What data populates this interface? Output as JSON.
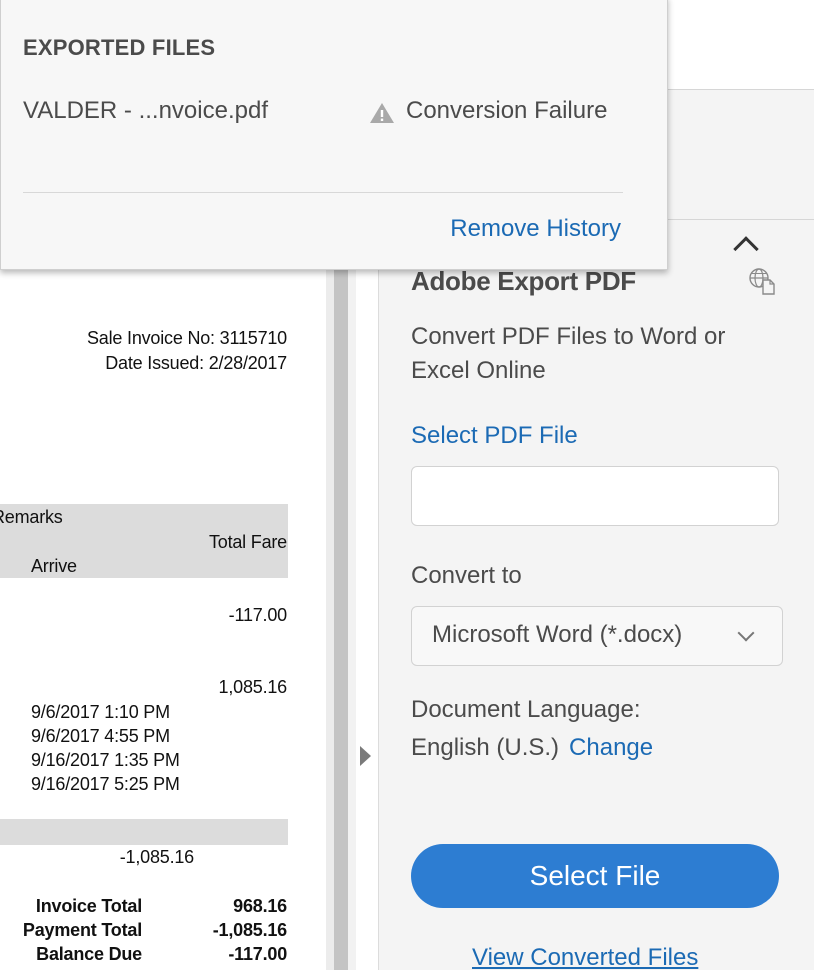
{
  "exported_files_popup": {
    "heading": "EXPORTED FILES",
    "file_name": "VALDER - ...nvoice.pdf",
    "status": "Conversion Failure",
    "remove_history": "Remove History"
  },
  "document": {
    "sale_invoice_no": "Sale Invoice No: 3115710",
    "date_issued": "Date Issued: 2/28/2017",
    "header_remarks": "Remarks",
    "header_total_fare": "Total Fare",
    "header_arrive": "Arrive",
    "amount_1": "-117.00",
    "amount_2": "1,085.16",
    "dates": [
      "9/6/2017 1:10 PM",
      "9/6/2017 4:55 PM",
      "9/16/2017 1:35 PM",
      "9/16/2017 5:25 PM"
    ],
    "amount_3": "-1,085.16",
    "totals": [
      {
        "label": "Invoice Total",
        "value": "968.16"
      },
      {
        "label": "Payment Total",
        "value": "-1,085.16"
      },
      {
        "label": "Balance Due",
        "value": "-117.00"
      }
    ]
  },
  "export_panel": {
    "title": "Adobe Export PDF",
    "description": "Convert PDF Files to Word or Excel Online",
    "select_pdf_link": "Select PDF File",
    "convert_to_label": "Convert to",
    "format_selected": "Microsoft Word (*.docx)",
    "doc_language_label": "Document Language:",
    "language": "English (U.S.)",
    "change_link": "Change",
    "select_file_button": "Select File",
    "view_converted_link": "View Converted Files"
  },
  "colors": {
    "link": "#1b6ab4",
    "button": "#2d7dd2",
    "panel_bg": "#f4f4f4"
  },
  "icons": [
    "warning-icon",
    "globe-document-icon",
    "chevron-up-icon",
    "chevron-down-icon",
    "collapse-arrow-icon"
  ]
}
